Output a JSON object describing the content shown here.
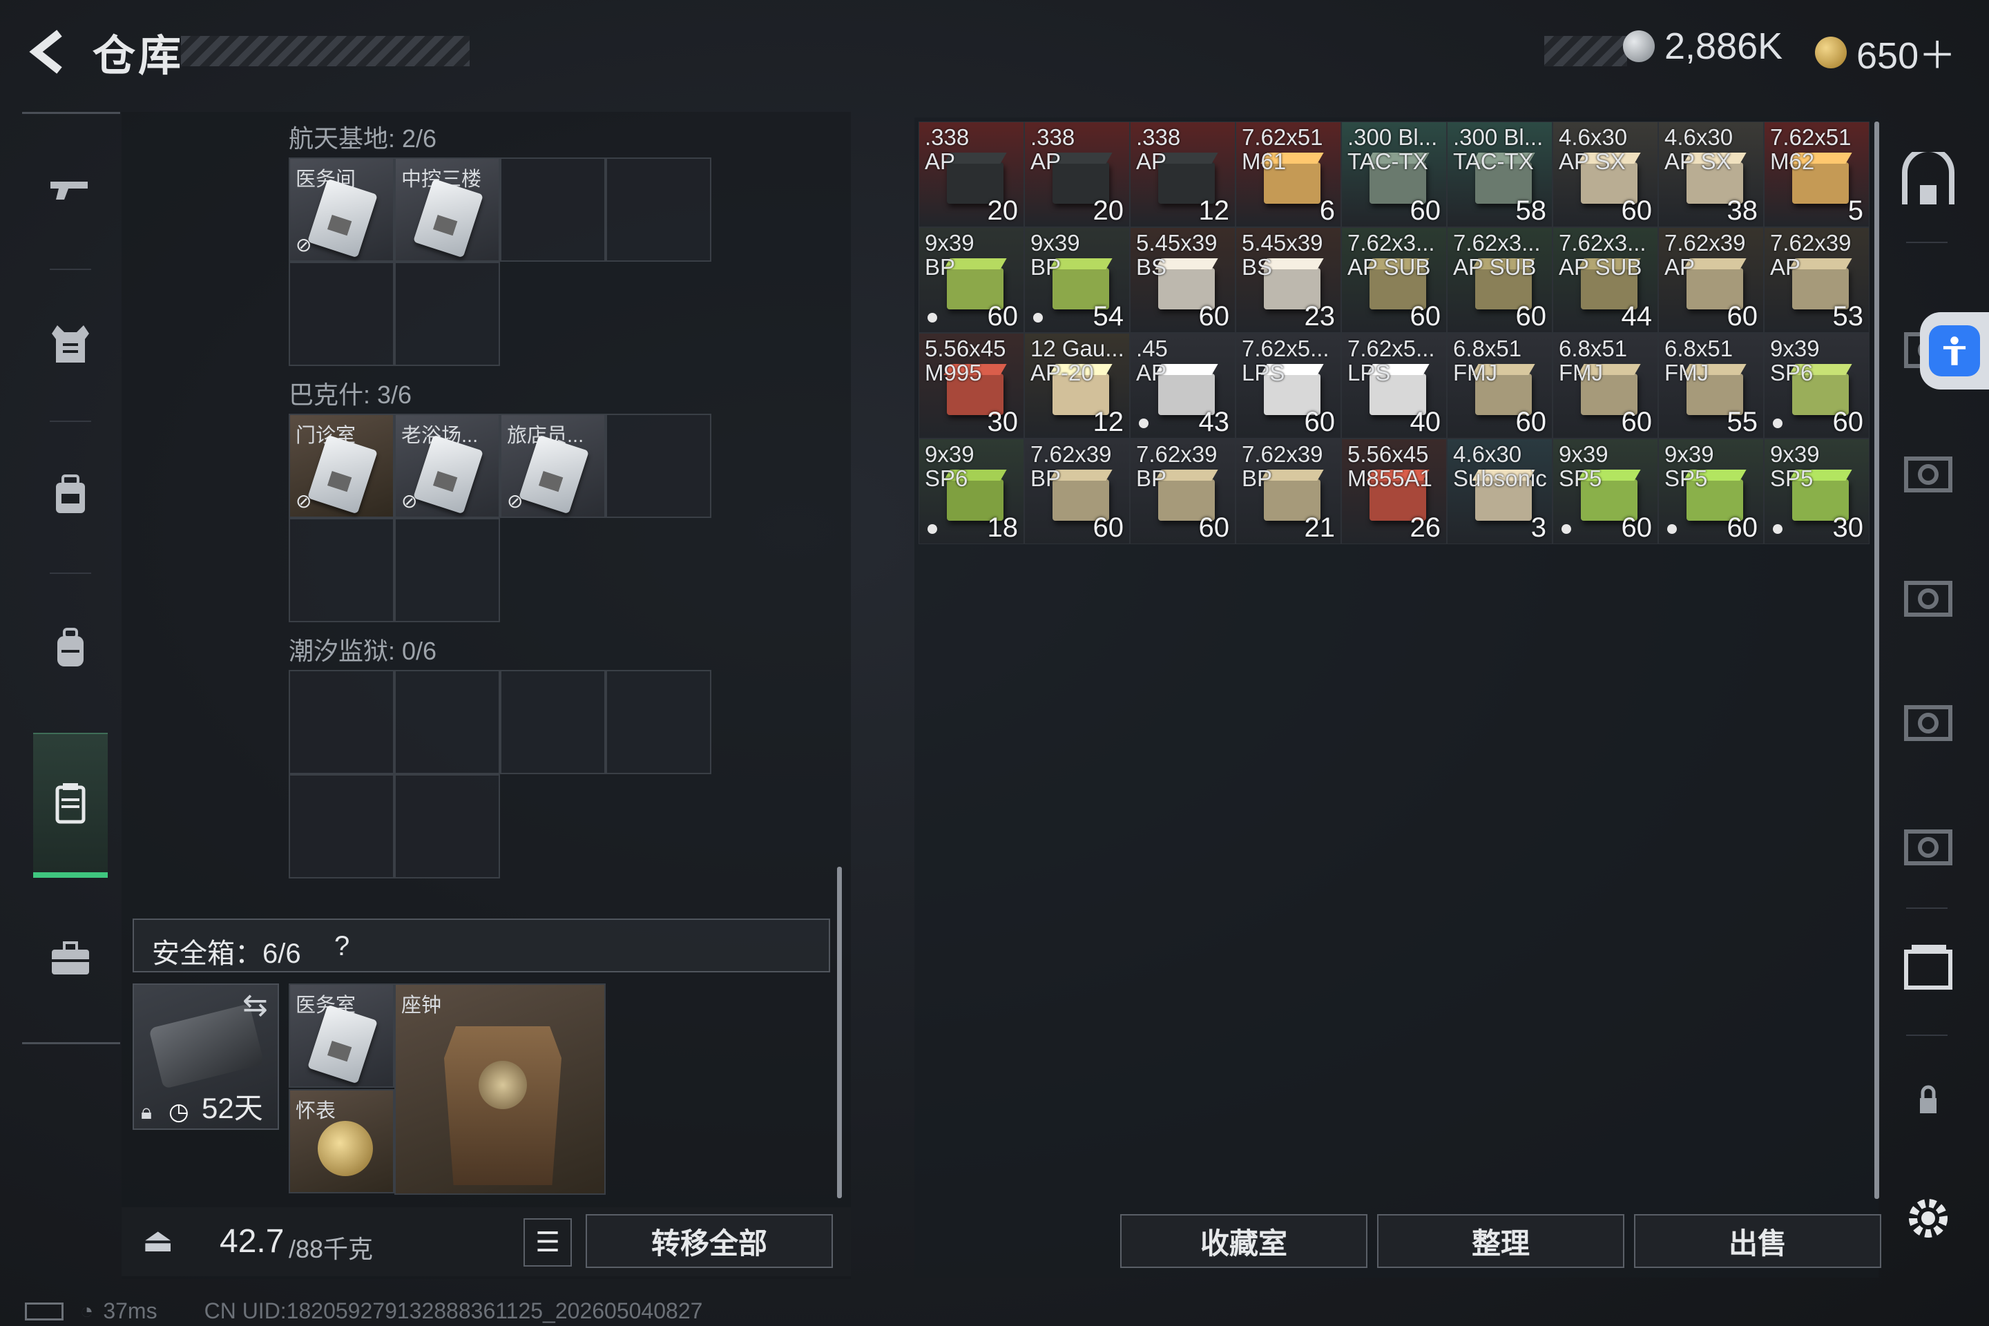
{
  "header": {
    "title": "仓库",
    "silver": "2,886K",
    "gold": "650＋"
  },
  "left": {
    "section1": {
      "label": "航天基地: 2/6",
      "items": [
        "医务间",
        "中控三楼"
      ]
    },
    "section2": {
      "label": "巴克什: 3/6",
      "items": [
        "门诊室",
        "老浴场...",
        "旅店员..."
      ]
    },
    "section3": {
      "label": "潮汐监狱: 0/6"
    },
    "safebox": {
      "label": "安全箱：6/6",
      "help": "?",
      "days": "52天",
      "items": {
        "a": "医务室",
        "b": "座钟",
        "c": "怀表"
      }
    },
    "weight": {
      "value": "42.7",
      "cap": "/88千克"
    },
    "transfer_all": "转移全部"
  },
  "ammo": [
    {
      "t": ".338\nAP",
      "n": "20",
      "c": "#5a2424",
      "b": "#2b2e30"
    },
    {
      "t": ".338\nAP",
      "n": "20",
      "c": "#5a2424",
      "b": "#2b2e30"
    },
    {
      "t": ".338\nAP",
      "n": "12",
      "c": "#5a2424",
      "b": "#2b2e30"
    },
    {
      "t": "7.62x51\nM61",
      "n": "6",
      "c": "#5a2424",
      "b": "#c59a55"
    },
    {
      "t": ".300 Bl...\nTAC-TX",
      "n": "60",
      "c": "#2c4a44",
      "b": "#6a7a6e"
    },
    {
      "t": ".300 Bl...\nTAC-TX",
      "n": "58",
      "c": "#2c4a44",
      "b": "#6a7a6e"
    },
    {
      "t": "4.6x30\nAP SX",
      "n": "60",
      "c": "#3b3a36",
      "b": "#b9ad93"
    },
    {
      "t": "4.6x30\nAP SX",
      "n": "38",
      "c": "#3b3a36",
      "b": "#b9ad93"
    },
    {
      "t": "7.62x51\nM62",
      "n": "5",
      "c": "#5a2424",
      "b": "#c59a55"
    },
    {
      "t": "9x39\nBP",
      "n": "60",
      "c": "#2d3330",
      "b": "#8ca84a",
      "d": true
    },
    {
      "t": "9x39\nBP",
      "n": "54",
      "c": "#2d3330",
      "b": "#8ca84a",
      "d": true
    },
    {
      "t": "5.45x39\nBS",
      "n": "60",
      "c": "#3a2c28",
      "b": "#bdb8ae"
    },
    {
      "t": "5.45x39\nBS",
      "n": "23",
      "c": "#3a2c28",
      "b": "#bdb8ae"
    },
    {
      "t": "7.62x3...\nAP SUB",
      "n": "60",
      "c": "#2b3a30",
      "b": "#8a8058"
    },
    {
      "t": "7.62x3...\nAP SUB",
      "n": "60",
      "c": "#2b3a30",
      "b": "#8a8058"
    },
    {
      "t": "7.62x3...\nAP SUB",
      "n": "44",
      "c": "#2b3a30",
      "b": "#8a8058"
    },
    {
      "t": "7.62x39\nAP",
      "n": "60",
      "c": "#37332c",
      "b": "#a69a7a"
    },
    {
      "t": "7.62x39\nAP",
      "n": "53",
      "c": "#37332c",
      "b": "#a69a7a"
    },
    {
      "t": "5.56x45\nM995",
      "n": "30",
      "c": "#3a2a2a",
      "b": "#a8483a"
    },
    {
      "t": "12 Gau...\nAP-20",
      "n": "12",
      "c": "#38342c",
      "b": "#d2c09a"
    },
    {
      "t": ".45\nAP",
      "n": "43",
      "c": "#2e3036",
      "b": "#c8c8c8",
      "d": true
    },
    {
      "t": "7.62x5...\nLPS",
      "n": "60",
      "c": "#2e3036",
      "b": "#d8d8d8"
    },
    {
      "t": "7.62x5...\nLPS",
      "n": "40",
      "c": "#2e3036",
      "b": "#d8d8d8"
    },
    {
      "t": "6.8x51\nFMJ",
      "n": "60",
      "c": "#2e3036",
      "b": "#a69a7a"
    },
    {
      "t": "6.8x51\nFMJ",
      "n": "60",
      "c": "#2e3036",
      "b": "#a69a7a"
    },
    {
      "t": "6.8x51\nFMJ",
      "n": "55",
      "c": "#2e3036",
      "b": "#a69a7a"
    },
    {
      "t": "9x39\nSP6",
      "n": "60",
      "c": "#2e3036",
      "b": "#9aae5a",
      "d": true
    },
    {
      "t": "9x39\nSP6",
      "n": "18",
      "c": "#2e3a32",
      "b": "#7fa040",
      "d": true
    },
    {
      "t": "7.62x39\nBP",
      "n": "60",
      "c": "#2e3036",
      "b": "#a69a7a"
    },
    {
      "t": "7.62x39\nBP",
      "n": "60",
      "c": "#2e3036",
      "b": "#a69a7a"
    },
    {
      "t": "7.62x39\nBP",
      "n": "21",
      "c": "#2e3036",
      "b": "#a69a7a"
    },
    {
      "t": "5.56x45\nM855A1",
      "n": "26",
      "c": "#3a2a2a",
      "b": "#a8483a"
    },
    {
      "t": "4.6x30\nSubsonic",
      "n": "3",
      "c": "#2a3a40",
      "b": "#b9ad93"
    },
    {
      "t": "9x39\nSP5",
      "n": "60",
      "c": "#2e3a32",
      "b": "#8ab04a",
      "d": true
    },
    {
      "t": "9x39\nSP5",
      "n": "60",
      "c": "#2e3a32",
      "b": "#8ab04a",
      "d": true
    },
    {
      "t": "9x39\nSP5",
      "n": "30",
      "c": "#2e3a32",
      "b": "#8ab04a",
      "d": true
    }
  ],
  "buttons": {
    "collection": "收藏室",
    "sort": "整理",
    "sell": "出售"
  },
  "status": {
    "ping": "37ms",
    "uid": "CN UID:182059279132888361125_202605040827"
  }
}
